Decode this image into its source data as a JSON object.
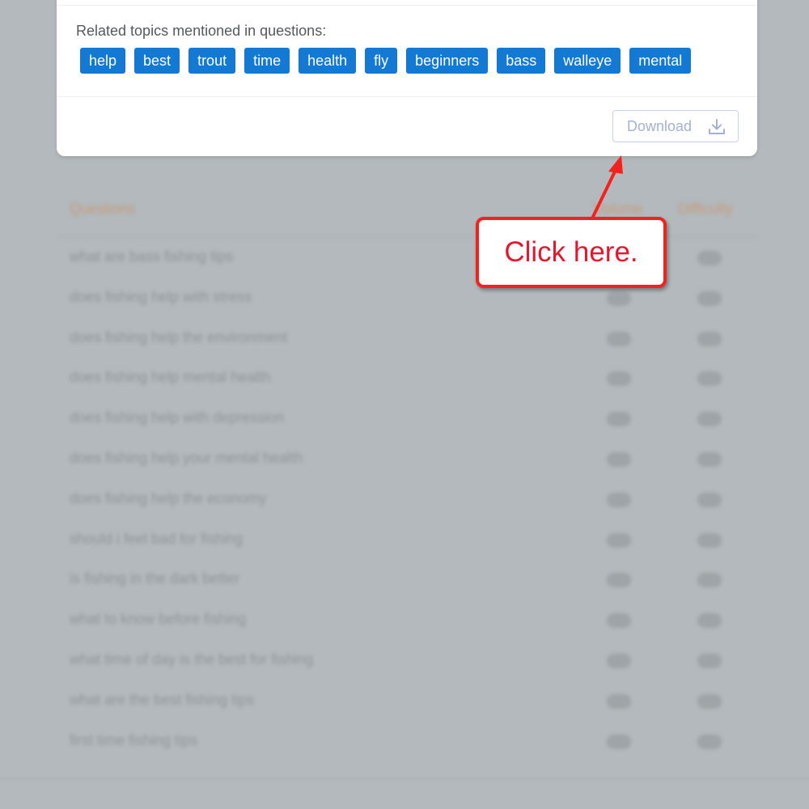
{
  "topics": {
    "label": "Related topics mentioned in questions:",
    "tags": [
      "help",
      "best",
      "trout",
      "time",
      "health",
      "fly",
      "beginners",
      "bass",
      "walleye",
      "mental"
    ]
  },
  "download": {
    "label": "Download",
    "icon": "download-icon"
  },
  "table": {
    "headers": {
      "questions": "Questions",
      "volume": "Volume",
      "difficulty": "Difficulty"
    },
    "rows": [
      "what are bass fishing tips",
      "does fishing help with stress",
      "does fishing help the environment",
      "does fishing help mental health",
      "does fishing help with depression",
      "does fishing help your mental health",
      "does fishing help the economy",
      "should i feel bad for fishing",
      "is fishing in the dark better",
      "what to know before fishing",
      "what time of day is the best for fishing",
      "what are the best fishing tips",
      "first time fishing tips"
    ]
  },
  "callout": {
    "text": "Click here."
  },
  "colors": {
    "tag_bg": "#1479d2",
    "callout_red": "#f2231e",
    "header_orange": "#c89a7c"
  }
}
